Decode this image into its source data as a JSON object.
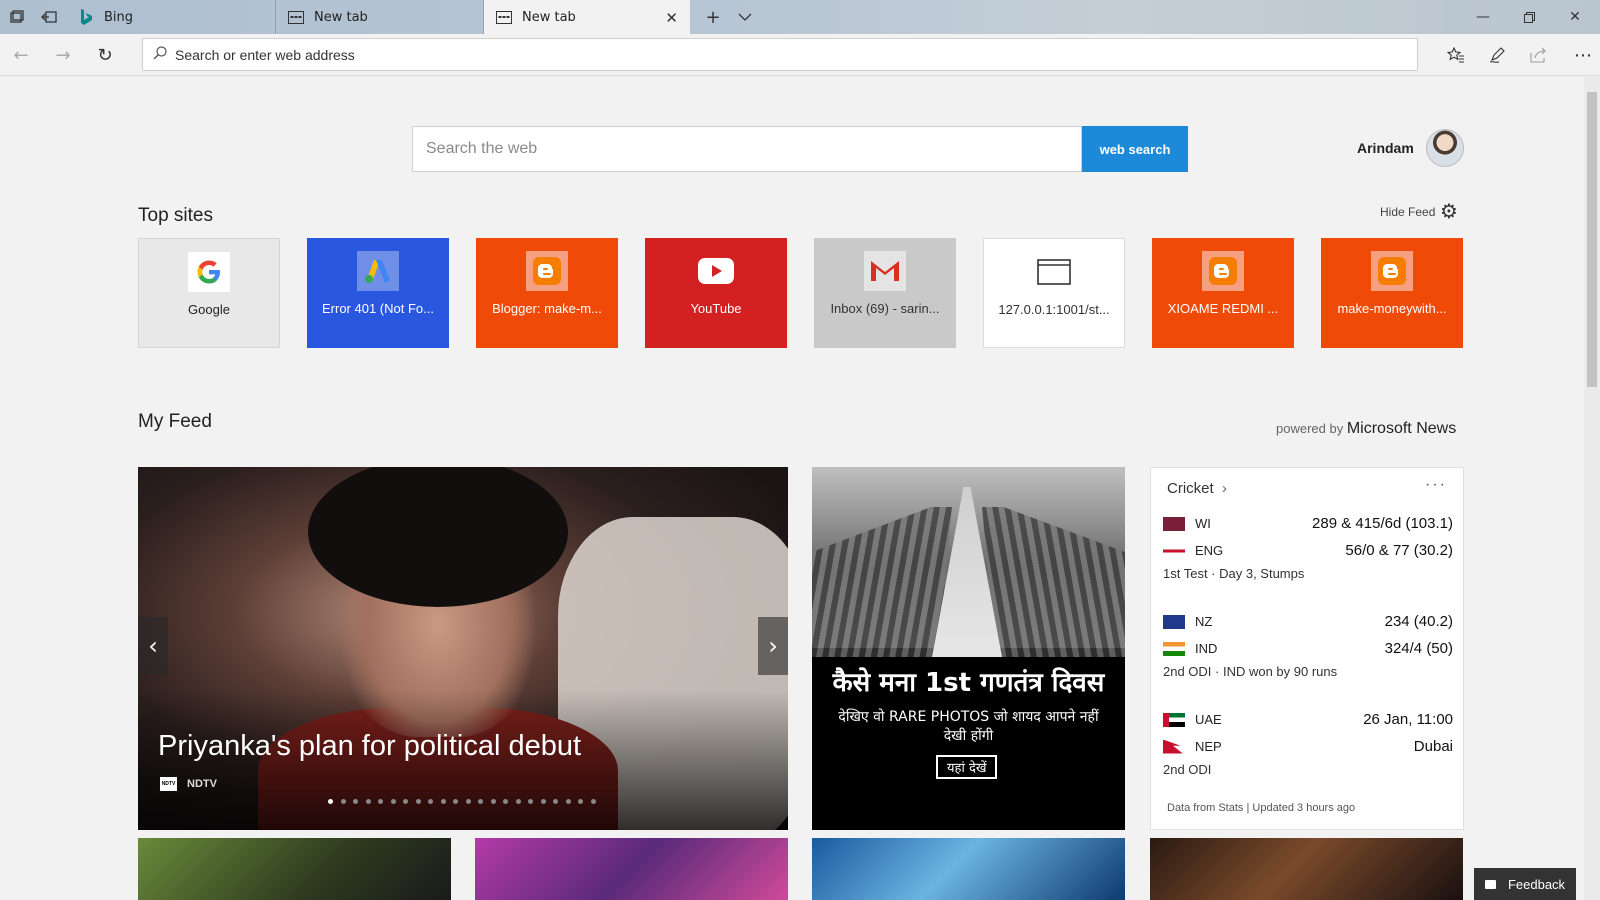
{
  "browser": {
    "tabs": [
      {
        "label": "Bing"
      },
      {
        "label": "New tab"
      },
      {
        "label": "New tab"
      }
    ],
    "address_placeholder": "Search or enter web address"
  },
  "search": {
    "placeholder": "Search the web",
    "button_label": "web search"
  },
  "user": {
    "name": "Arindam"
  },
  "top_sites": {
    "title": "Top sites",
    "hide_feed_label": "Hide Feed",
    "items": [
      {
        "label": "Google",
        "icon": "google-icon",
        "color": "#e8e8e8"
      },
      {
        "label": "Error 401 (Not Fo...",
        "icon": "google-ads-icon",
        "color": "#2957e0"
      },
      {
        "label": "Blogger: make-m...",
        "icon": "blogger-icon",
        "color": "#f04a08"
      },
      {
        "label": "YouTube",
        "icon": "youtube-icon",
        "color": "#d32020"
      },
      {
        "label": "Inbox (69) - sarin...",
        "icon": "gmail-icon",
        "color": "#c9c9c9"
      },
      {
        "label": "127.0.0.1:1001/st...",
        "icon": "browser-window-icon",
        "color": "#ffffff"
      },
      {
        "label": "XIOAME REDMI ...",
        "icon": "blogger-icon",
        "color": "#f04a08"
      },
      {
        "label": "make-moneywith...",
        "icon": "blogger-icon",
        "color": "#f04a08"
      }
    ]
  },
  "feed": {
    "title": "My Feed",
    "powered_prefix": "powered by",
    "powered_brand": "Microsoft News",
    "hero": {
      "headline": "Priyanka's plan for political debut",
      "source": "NDTV",
      "source_logo_text": "NDTV",
      "slide_count": 22,
      "active_slide": 1
    },
    "promo": {
      "headline": "कैसे मना 1st गणतंत्र दिवस",
      "subhead": "देखिए वो RARE PHOTOS जो शायद आपने नहीं देखी होंगी",
      "cta": "यहां देखें"
    },
    "cricket": {
      "title": "Cricket",
      "more": "···",
      "matches": [
        {
          "teams": [
            {
              "name": "WI",
              "score": "289 & 415/6d (103.1)"
            },
            {
              "name": "ENG",
              "score": "56/0 & 77 (30.2)"
            }
          ],
          "status": "1st Test · Day 3, Stumps"
        },
        {
          "teams": [
            {
              "name": "NZ",
              "score": "234 (40.2)"
            },
            {
              "name": "IND",
              "score": "324/4 (50)"
            }
          ],
          "status": "2nd ODI · IND won by 90 runs"
        },
        {
          "teams": [
            {
              "name": "UAE",
              "score": "26 Jan, 11:00"
            },
            {
              "name": "NEP",
              "score": "Dubai"
            }
          ],
          "status": "2nd ODI"
        }
      ],
      "footer": "Data from Stats | Updated 3 hours ago"
    }
  },
  "feedback_label": "Feedback"
}
